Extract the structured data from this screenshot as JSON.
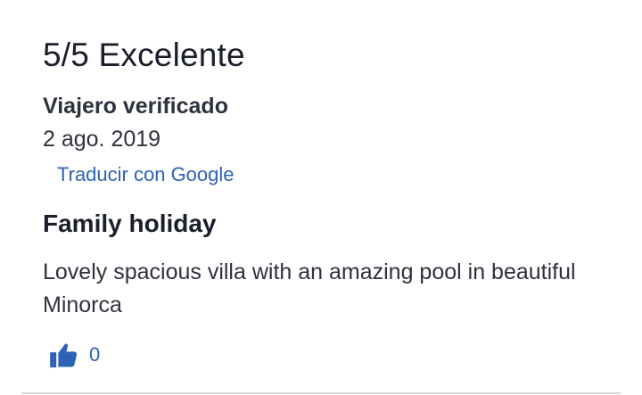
{
  "review": {
    "rating_title": "5/5 Excelente",
    "reviewer": "Viajero verificado",
    "date": "2 ago. 2019",
    "translate_link": "Traducir con Google",
    "heading": "Family holiday",
    "body": "Lovely spacious villa with an amazing pool in beautiful Minorca",
    "helpful": {
      "icon": "thumbs-up-icon",
      "count": "0"
    }
  },
  "colors": {
    "text": "#2e323d",
    "link": "#2e62b5",
    "divider": "#d5d7dc"
  }
}
